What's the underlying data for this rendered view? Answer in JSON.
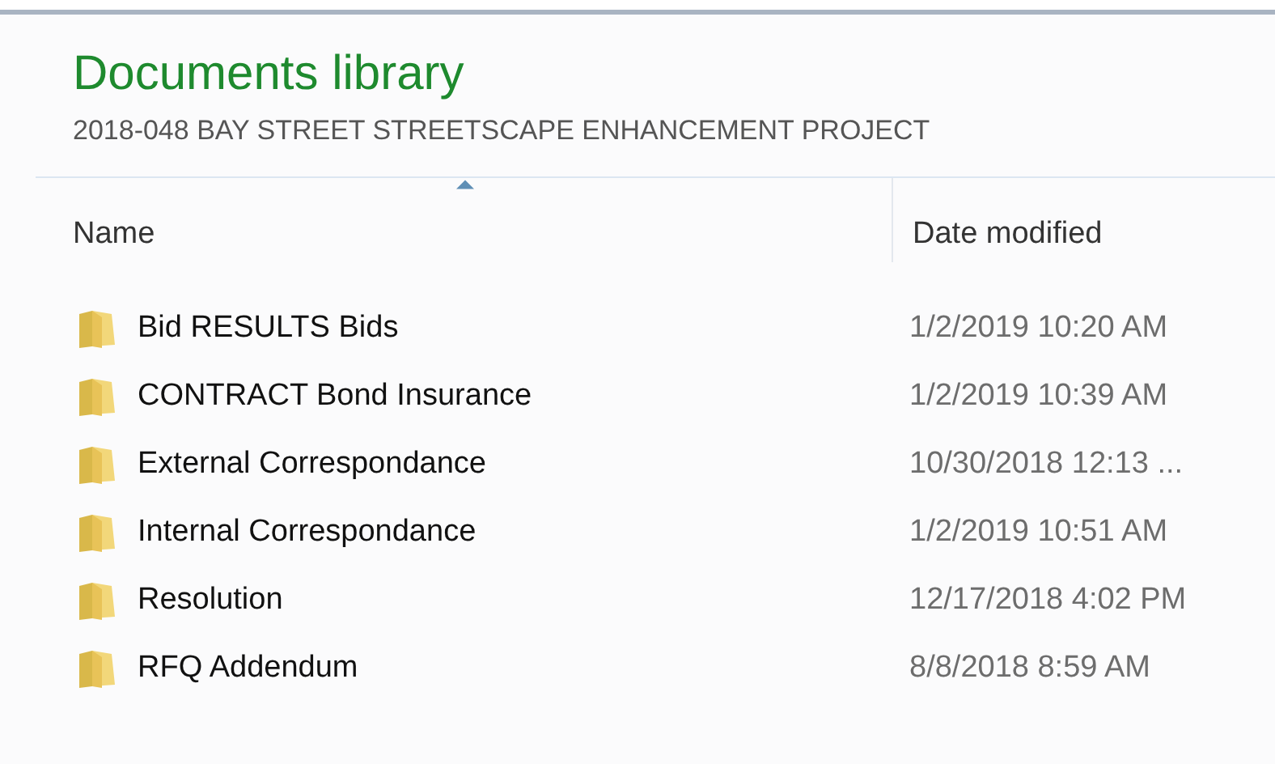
{
  "library": {
    "title": "Documents library",
    "subtitle": "2018-048 BAY STREET STREETSCAPE ENHANCEMENT PROJECT"
  },
  "columns": [
    {
      "label": "Name",
      "sorted": true
    },
    {
      "label": "Date modified",
      "sorted": false
    }
  ],
  "rows": [
    {
      "name": "Bid RESULTS Bids",
      "date": "1/2/2019 10:20 AM"
    },
    {
      "name": "CONTRACT Bond Insurance",
      "date": "1/2/2019 10:39 AM"
    },
    {
      "name": "External Correspondance",
      "date": "10/30/2018 12:13 ..."
    },
    {
      "name": "Internal Correspondance",
      "date": "1/2/2019 10:51 AM"
    },
    {
      "name": "Resolution",
      "date": "12/17/2018 4:02 PM"
    },
    {
      "name": "RFQ Addendum",
      "date": "8/8/2018 8:59 AM"
    }
  ]
}
